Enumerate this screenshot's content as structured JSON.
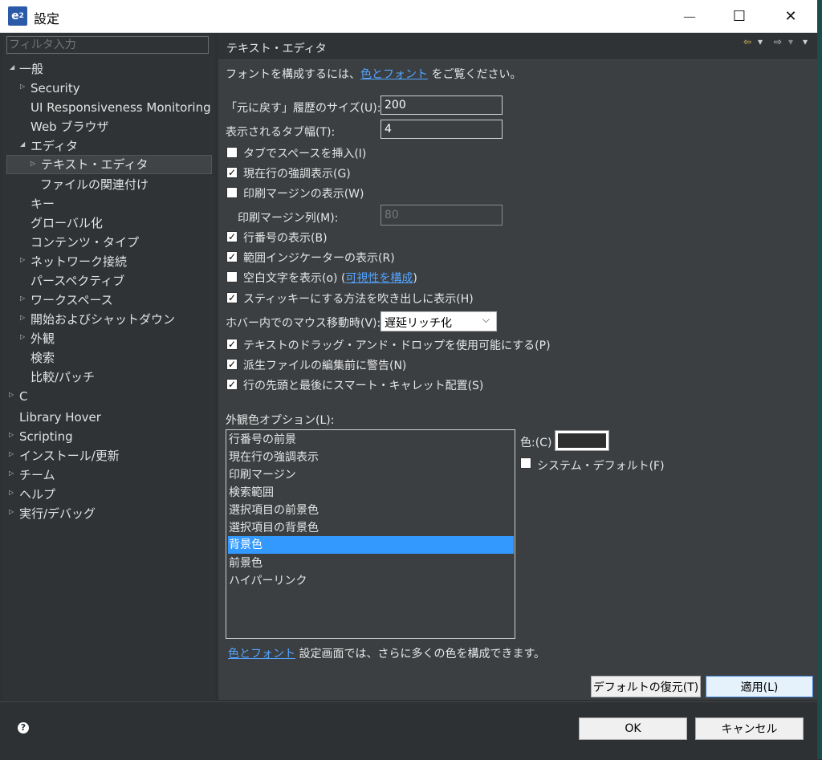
{
  "window": {
    "title": "設定",
    "logo_text": "e",
    "logo_sup": "2",
    "minimize_glyph": "—",
    "maximize_glyph": "☐",
    "close_glyph": "✕"
  },
  "sidebar": {
    "filter_placeholder": "フィルタ入力",
    "items": [
      {
        "label": "一般",
        "arrow": "◢"
      },
      {
        "label": "Security",
        "arrow": "▷"
      },
      {
        "label": "UI Responsiveness Monitoring",
        "arrow": ""
      },
      {
        "label": "Web ブラウザ",
        "arrow": ""
      },
      {
        "label": "エディタ",
        "arrow": "◢"
      },
      {
        "label": "テキスト・エディタ",
        "arrow": "▷"
      },
      {
        "label": "ファイルの関連付け",
        "arrow": ""
      },
      {
        "label": "キー",
        "arrow": ""
      },
      {
        "label": "グローバル化",
        "arrow": ""
      },
      {
        "label": "コンテンツ・タイプ",
        "arrow": ""
      },
      {
        "label": "ネットワーク接続",
        "arrow": "▷"
      },
      {
        "label": "パースペクティブ",
        "arrow": ""
      },
      {
        "label": "ワークスペース",
        "arrow": "▷"
      },
      {
        "label": "開始およびシャットダウン",
        "arrow": "▷"
      },
      {
        "label": "外観",
        "arrow": "▷"
      },
      {
        "label": "検索",
        "arrow": ""
      },
      {
        "label": "比較/パッチ",
        "arrow": ""
      },
      {
        "label": "C",
        "arrow": "▷"
      },
      {
        "label": "Library Hover",
        "arrow": ""
      },
      {
        "label": "Scripting",
        "arrow": "▷"
      },
      {
        "label": "インストール/更新",
        "arrow": "▷"
      },
      {
        "label": "チーム",
        "arrow": "▷"
      },
      {
        "label": "ヘルプ",
        "arrow": "▷"
      },
      {
        "label": "実行/デバッグ",
        "arrow": "▷"
      }
    ]
  },
  "page": {
    "title": "テキスト・エディタ",
    "nav_back": "⇦",
    "nav_forward": "⇨",
    "nav_menu": "▾",
    "intro_prefix": "フォントを構成するには、",
    "intro_link": "色とフォント",
    "intro_suffix": " をご覧ください。",
    "undo_label": "「元に戻す」履歴のサイズ(U):",
    "undo_value": "200",
    "tab_label": "表示されるタブ幅(T):",
    "tab_value": "4",
    "cb_spaces": "タブでスペースを挿入(I)",
    "cb_highlight": "現在行の強調表示(G)",
    "cb_margin": "印刷マージンの表示(W)",
    "margin_col_label": "印刷マージン列(M):",
    "margin_col_value": "80",
    "cb_line_numbers": "行番号の表示(B)",
    "cb_range": "範囲インジケーターの表示(R)",
    "cb_whitespace": "空白文字を表示(o) (",
    "whitespace_link": "可視性を構成",
    "whitespace_close": ")",
    "cb_sticky": "スティッキーにする方法を吹き出しに表示(H)",
    "hover_label": "ホバー内でのマウス移動時(V):",
    "hover_value": "遅延リッチ化",
    "cb_dnd": "テキストのドラッグ・アンド・ドロップを使用可能にする(P)",
    "cb_derived": "派生ファイルの編集前に警告(N)",
    "cb_smart": "行の先頭と最後にスマート・キャレット配置(S)",
    "appearance_label": "外観色オプション(L):",
    "color_items": [
      "行番号の前景",
      "現在行の強調表示",
      "印刷マージン",
      "検索範囲",
      "選択項目の前景色",
      "選択項目の背景色",
      "背景色",
      "前景色",
      "ハイパーリンク"
    ],
    "color_label": "色:(C)",
    "system_default": "システム・デフォルト(F)",
    "bottom_link": "色とフォント",
    "bottom_text": " 設定画面では、さらに多くの色を構成できます。",
    "restore_button": "デフォルトの復元(T)",
    "apply_button": "適用(L)"
  },
  "footer": {
    "help_glyph": "?",
    "ok_button": "OK",
    "cancel_button": "キャンセル"
  },
  "checked_glyph": "✓"
}
